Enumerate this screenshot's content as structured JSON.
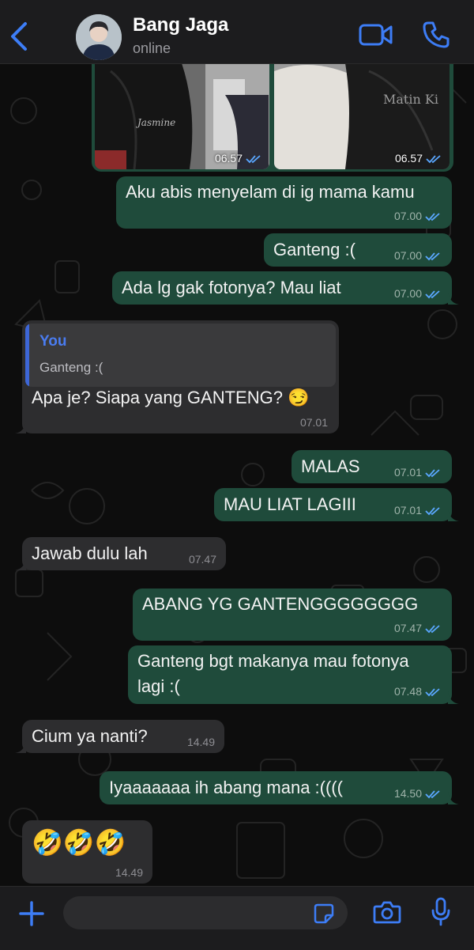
{
  "header": {
    "contact_name": "Bang Jaga",
    "status": "online"
  },
  "photos": [
    {
      "time": "06.57",
      "overlay_text": "Jasmine"
    },
    {
      "time": "06.57",
      "overlay_text": "Matin Ki"
    }
  ],
  "messages": [
    {
      "dir": "out",
      "text": "Aku abis menyelam di ig mama kamu",
      "time": "07.00"
    },
    {
      "dir": "out",
      "text": "Ganteng :(",
      "time": "07.00"
    },
    {
      "dir": "out",
      "text": "Ada lg gak fotonya? Mau liat",
      "time": "07.00"
    },
    {
      "dir": "in",
      "reply_name": "You",
      "reply_text": "Ganteng :(",
      "text": "Apa je? Siapa yang GANTENG? 😏",
      "time": "07.01"
    },
    {
      "dir": "out",
      "text": "MALAS",
      "time": "07.01"
    },
    {
      "dir": "out",
      "text": "MAU LIAT LAGIII",
      "time": "07.01"
    },
    {
      "dir": "in",
      "text": "Jawab dulu lah",
      "time": "07.47"
    },
    {
      "dir": "out",
      "text": "ABANG YG GANTENGGGGGGGG",
      "time": "07.47"
    },
    {
      "dir": "out",
      "text_line1": "Ganteng bgt makanya mau fotonya",
      "text_line2": "lagi :(",
      "time": "07.48"
    },
    {
      "dir": "in",
      "text": "Cium ya nanti?",
      "time": "14.49"
    },
    {
      "dir": "out",
      "text": "Iyaaaaaaa ih abang mana :((((",
      "time": "14.50"
    },
    {
      "dir": "in",
      "text": "🤣🤣🤣",
      "time": "14.49"
    }
  ],
  "composer": {
    "placeholder": "",
    "value": ""
  },
  "colors": {
    "outgoing_bubble": "#1f4b3b",
    "incoming_bubble": "#2d2d2f",
    "accent": "#3d7df6",
    "read_tick": "#5aa7ff"
  },
  "icons": [
    "back-chevron-icon",
    "video-call-icon",
    "phone-icon",
    "plus-icon",
    "sticker-icon",
    "camera-icon",
    "microphone-icon",
    "read-receipt-icon"
  ]
}
